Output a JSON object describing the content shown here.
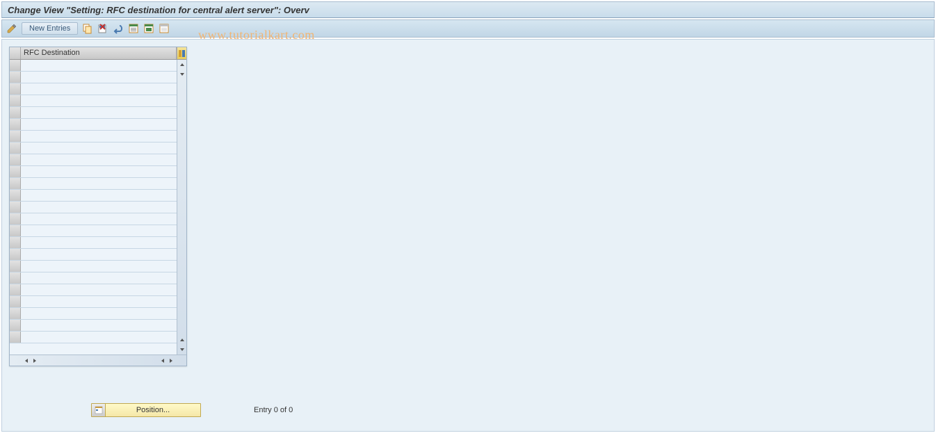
{
  "title": "Change View \"Setting: RFC destination for central alert server\": Overv",
  "toolbar": {
    "new_entries_label": "New Entries"
  },
  "watermark": "www.tutorialkart.com",
  "table": {
    "column_header": "RFC Destination",
    "rows": [
      "",
      "",
      "",
      "",
      "",
      "",
      "",
      "",
      "",
      "",
      "",
      "",
      "",
      "",
      "",
      "",
      "",
      "",
      "",
      "",
      "",
      "",
      "",
      ""
    ]
  },
  "footer": {
    "position_label": "Position...",
    "entry_status": "Entry 0 of 0"
  }
}
